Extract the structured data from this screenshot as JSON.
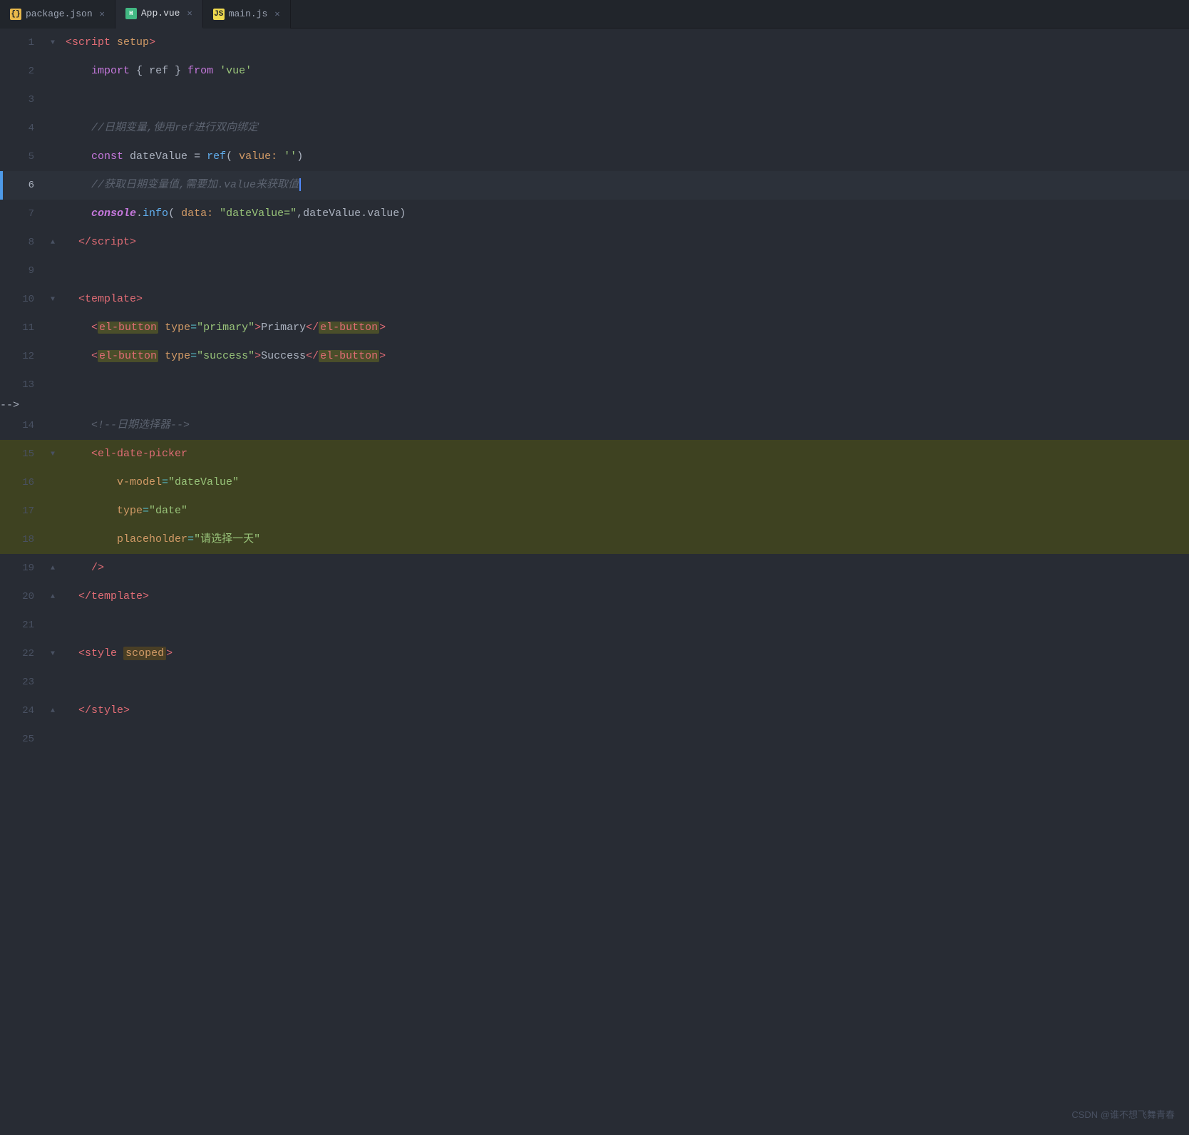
{
  "tabs": [
    {
      "id": "package-json",
      "icon": "json",
      "label": "package.json",
      "active": false
    },
    {
      "id": "app-vue",
      "icon": "vue",
      "label": "App.vue",
      "active": true
    },
    {
      "id": "main-js",
      "icon": "js",
      "label": "main.js",
      "active": false
    }
  ],
  "lines": [
    {
      "num": 1,
      "fold": "▼",
      "indent": 2
    },
    {
      "num": 2,
      "indent": 3
    },
    {
      "num": 3,
      "indent": 0
    },
    {
      "num": 4,
      "indent": 3
    },
    {
      "num": 5,
      "indent": 3
    },
    {
      "num": 6,
      "indent": 3,
      "active": true
    },
    {
      "num": 7,
      "indent": 3
    },
    {
      "num": 8,
      "indent": 2,
      "fold": "▲"
    },
    {
      "num": 9,
      "indent": 0
    },
    {
      "num": 10,
      "indent": 2,
      "fold": "▼"
    },
    {
      "num": 11,
      "indent": 3
    },
    {
      "num": 12,
      "indent": 3
    },
    {
      "num": 13,
      "indent": 0
    },
    {
      "num": 14,
      "indent": 3
    },
    {
      "num": 15,
      "indent": 3,
      "fold": "▼",
      "highlighted": true
    },
    {
      "num": 16,
      "indent": 4,
      "highlighted": true
    },
    {
      "num": 17,
      "indent": 4,
      "highlighted": true
    },
    {
      "num": 18,
      "indent": 4,
      "highlighted": true
    },
    {
      "num": 19,
      "indent": 3,
      "fold": "▲"
    },
    {
      "num": 20,
      "indent": 2,
      "fold": "▲"
    },
    {
      "num": 21,
      "indent": 0
    },
    {
      "num": 22,
      "indent": 2,
      "fold": "▼"
    },
    {
      "num": 23,
      "indent": 0
    },
    {
      "num": 24,
      "indent": 2,
      "fold": "▲"
    },
    {
      "num": 25,
      "indent": 0
    }
  ],
  "watermark": "CSDN @谁不想飞舞青春"
}
